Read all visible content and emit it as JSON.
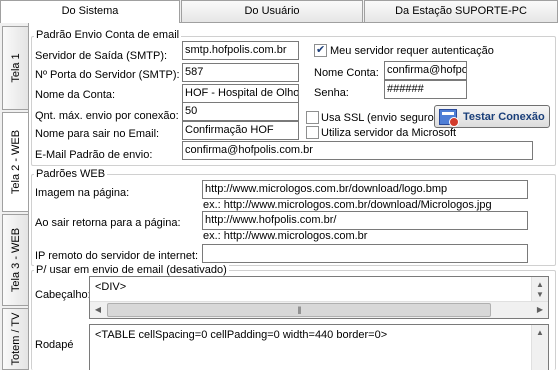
{
  "top_tabs": [
    "Do Sistema",
    "Do Usuário",
    "Da Estação SUPORTE-PC"
  ],
  "side_tabs": [
    "Tela 1",
    "Tela 2 - WEB",
    "Tela 3 - WEB",
    "Totem / TV"
  ],
  "email_group": {
    "title": "Padrão Envio Conta de email",
    "smtp_server_label": "Servidor de Saída (SMTP):",
    "smtp_server_value": "smtp.hofpolis.com.br",
    "smtp_port_label": "Nº Porta do Servidor (SMTP):",
    "smtp_port_value": "587",
    "account_name_label": "Nome da Conta:",
    "account_name_value": "HOF - Hospital de Olhos",
    "max_send_label": "Qnt. máx. envio por conexão:",
    "max_send_value": "50",
    "sender_name_label": "Nome para sair no Email:",
    "sender_name_value": "Confirmação HOF",
    "default_email_label": "E-Mail Padrão de envio:",
    "default_email_value": "confirma@hofpolis.com.br",
    "auth_label": "Meu servidor requer autenticação",
    "auth_checked": true,
    "account_label": "Nome Conta:",
    "account_value": "confirma@hofpo",
    "password_label": "Senha:",
    "password_value": "######",
    "ssl_label": "Usa SSL (envio seguro)",
    "ssl_checked": false,
    "microsoft_label": "Utiliza servidor da Microsoft",
    "microsoft_checked": false,
    "test_button": "Testar Conexão",
    "test_button_icon": "network-test-icon"
  },
  "web_group": {
    "title": "Padrões WEB",
    "image_label": "Imagem na página:",
    "image_value": "http://www.micrologos.com.br/download/logo.bmp",
    "image_example": "ex.: http://www.micrologos.com.br/download/Micrologos.jpg",
    "return_label": "Ao sair retorna para a página:",
    "return_value": "http://www.hofpolis.com.br/",
    "return_example": "ex.: http://www.micrologos.com.br",
    "ip_label": "IP remoto do servidor de internet:",
    "ip_value": ""
  },
  "email_use_group": {
    "title": "P/ usar em envio de email (desativado)",
    "header_label": "Cabeçalho:",
    "header_value": "<DIV>",
    "footer_label": "Rodapé",
    "footer_value": "<TABLE cellSpacing=0 cellPadding=0 width=440 border=0>"
  }
}
